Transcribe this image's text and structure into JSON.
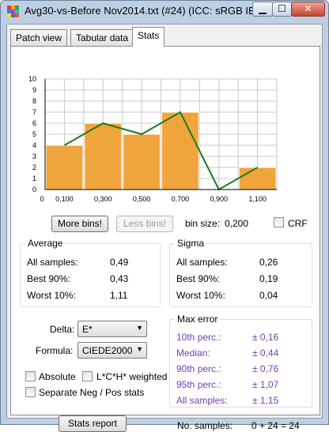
{
  "window": {
    "title": "Avg30-vs-Before Nov2014.txt (#24) (ICC: sRGB IEC...",
    "minimize_glyph": "▁",
    "maximize_glyph": "☐",
    "close_glyph": "✕"
  },
  "tabs": [
    {
      "label": "Patch view",
      "active": false
    },
    {
      "label": "Tabular data",
      "active": false
    },
    {
      "label": "Stats",
      "active": true
    }
  ],
  "chart_data": {
    "type": "bar",
    "categories": [
      "0,100",
      "0,300",
      "0,500",
      "0,700",
      "0,900",
      "1,100"
    ],
    "values": [
      4,
      6,
      5,
      7,
      0,
      2
    ],
    "x_axis_labels": [
      "0",
      "0,100",
      "0,300",
      "0,500",
      "0,700",
      "0,900",
      "1,100"
    ],
    "y_tick_labels": [
      "0",
      "1",
      "2",
      "3",
      "4",
      "5",
      "6",
      "7",
      "8",
      "9",
      "10"
    ],
    "ylim": [
      0,
      10
    ],
    "grid": true,
    "bar_color": "#f0a53c",
    "line_color": "#1f7a1f",
    "overlay_line": true
  },
  "controls": {
    "more_bins": "More bins!",
    "less_bins": "Less bins!",
    "bin_size_label": "bin size:",
    "bin_size_value": "0,200",
    "crf_label": "CRF",
    "crf_checked": false
  },
  "average": {
    "title": "Average",
    "rows": [
      {
        "label": "All samples:",
        "value": "0,49"
      },
      {
        "label": "Best 90%:",
        "value": "0,43"
      },
      {
        "label": "Worst 10%:",
        "value": "1,11"
      }
    ]
  },
  "sigma": {
    "title": "Sigma",
    "rows": [
      {
        "label": "All samples:",
        "value": "0,26"
      },
      {
        "label": "Best 90%:",
        "value": "0,19"
      },
      {
        "label": "Worst 10%:",
        "value": "0,04"
      }
    ]
  },
  "settings": {
    "delta_label": "Delta:",
    "delta_value": "E*",
    "formula_label": "Formula:",
    "formula_value": "CIEDE2000",
    "absolute_label": "Absolute",
    "lch_label": "L*C*H* weighted",
    "separate_label": "Separate Neg / Pos stats",
    "stats_report": "Stats report"
  },
  "max_error": {
    "title": "Max error",
    "rows": [
      {
        "label": "10th perc.:",
        "value": "± 0,16"
      },
      {
        "label": "Median:",
        "value": "± 0,44"
      },
      {
        "label": "90th perc.:",
        "value": "± 0,76"
      },
      {
        "label": "95th perc.:",
        "value": "± 1,07"
      },
      {
        "label": "All samples:",
        "value": "± 1,15"
      }
    ]
  },
  "samples": {
    "label": "No. samples:",
    "value": "0 + 24 = 24"
  }
}
